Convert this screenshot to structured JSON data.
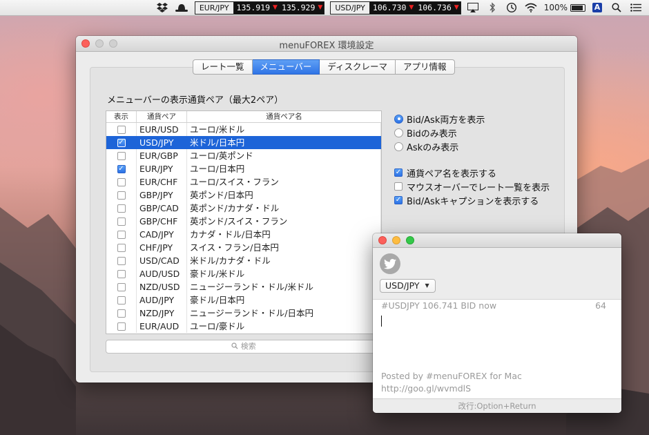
{
  "menubar": {
    "tickers": [
      {
        "symbol": "EUR/JPY",
        "bid": "135.919",
        "ask": "135.929"
      },
      {
        "symbol": "USD/JPY",
        "bid": "106.730",
        "ask": "106.736"
      }
    ],
    "battery": "100%",
    "ime": "A"
  },
  "prefs": {
    "title": "menuFOREX 環境設定",
    "tabs": [
      "レート一覧",
      "メニューバー",
      "ディスクレーマ",
      "アプリ情報"
    ],
    "active_tab": 1,
    "section_label": "メニューバーの表示通貨ペア（最大2ペア）",
    "columns": {
      "show": "表示",
      "pair": "通貨ペア",
      "name": "通貨ペア名"
    },
    "rows": [
      {
        "pair": "EUR/USD",
        "name": "ユーロ/米ドル",
        "checked": false,
        "selected": false
      },
      {
        "pair": "USD/JPY",
        "name": "米ドル/日本円",
        "checked": true,
        "selected": true
      },
      {
        "pair": "EUR/GBP",
        "name": "ユーロ/英ポンド",
        "checked": false,
        "selected": false
      },
      {
        "pair": "EUR/JPY",
        "name": "ユーロ/日本円",
        "checked": true,
        "selected": false
      },
      {
        "pair": "EUR/CHF",
        "name": "ユーロ/スイス・フラン",
        "checked": false,
        "selected": false
      },
      {
        "pair": "GBP/JPY",
        "name": "英ポンド/日本円",
        "checked": false,
        "selected": false
      },
      {
        "pair": "GBP/CAD",
        "name": "英ポンド/カナダ・ドル",
        "checked": false,
        "selected": false
      },
      {
        "pair": "GBP/CHF",
        "name": "英ポンド/スイス・フラン",
        "checked": false,
        "selected": false
      },
      {
        "pair": "CAD/JPY",
        "name": "カナダ・ドル/日本円",
        "checked": false,
        "selected": false
      },
      {
        "pair": "CHF/JPY",
        "name": "スイス・フラン/日本円",
        "checked": false,
        "selected": false
      },
      {
        "pair": "USD/CAD",
        "name": "米ドル/カナダ・ドル",
        "checked": false,
        "selected": false
      },
      {
        "pair": "AUD/USD",
        "name": "豪ドル/米ドル",
        "checked": false,
        "selected": false
      },
      {
        "pair": "NZD/USD",
        "name": "ニュージーランド・ドル/米ドル",
        "checked": false,
        "selected": false
      },
      {
        "pair": "AUD/JPY",
        "name": "豪ドル/日本円",
        "checked": false,
        "selected": false
      },
      {
        "pair": "NZD/JPY",
        "name": "ニュージーランド・ドル/日本円",
        "checked": false,
        "selected": false
      },
      {
        "pair": "EUR/AUD",
        "name": "ユーロ/豪ドル",
        "checked": false,
        "selected": false
      }
    ],
    "search_placeholder": "検索",
    "radios": [
      {
        "label": "Bid/Ask両方を表示",
        "on": true
      },
      {
        "label": "Bidのみ表示",
        "on": false
      },
      {
        "label": "Askのみ表示",
        "on": false
      }
    ],
    "checks": [
      {
        "label": "通貨ペア名を表示する",
        "on": true
      },
      {
        "label": "マウスオーバーでレート一覧を表示",
        "on": false
      },
      {
        "label": "Bid/Askキャプションを表示する",
        "on": true
      }
    ]
  },
  "tweet": {
    "pair": "USD/JPY",
    "text": "#USDJPY 106.741 BID now",
    "count": "64",
    "footer_line1": "Posted by #menuFOREX for Mac",
    "footer_line2": "http://goo.gl/wvmdlS",
    "hint": "改行:Option+Return"
  },
  "colors": {
    "accent": "#2f74e6",
    "selection": "#1d64d8",
    "close": "#fc605b",
    "minimize": "#fdbc40",
    "zoom": "#34c84a"
  }
}
